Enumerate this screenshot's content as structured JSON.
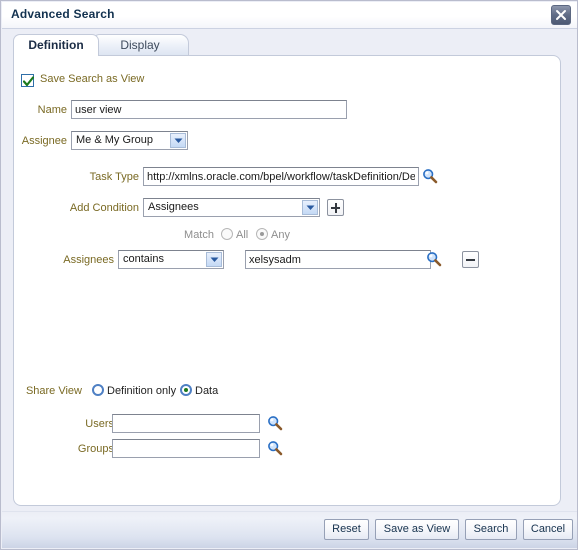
{
  "window": {
    "title": "Advanced Search",
    "close_icon": "close-icon"
  },
  "tabs": [
    {
      "label": "Definition",
      "active": true
    },
    {
      "label": "Display",
      "active": false
    }
  ],
  "form": {
    "save_search_as_view": {
      "label": "Save Search as View",
      "checked": true,
      "check_icon": "checkmark-icon"
    },
    "name": {
      "label": "Name",
      "value": "user view"
    },
    "assignee": {
      "label": "Assignee",
      "value": "Me & My Group"
    },
    "task_type": {
      "label": "Task Type",
      "value": "http://xmlns.oracle.com/bpel/workflow/taskDefinition/De",
      "search_icon": "magnifier-icon"
    },
    "add_condition": {
      "label": "Add Condition",
      "value": "Assignees",
      "add_icon": "plus-icon"
    },
    "match": {
      "label": "Match",
      "options": [
        {
          "label": "All",
          "selected": false
        },
        {
          "label": "Any",
          "selected": true
        }
      ]
    },
    "assignees_condition": {
      "label": "Assignees",
      "operator": "contains",
      "value": "xelsysadm",
      "search_icon": "magnifier-icon",
      "remove_icon": "minus-icon"
    }
  },
  "share_view": {
    "label": "Share View",
    "options": [
      {
        "label": "Definition only",
        "selected": false
      },
      {
        "label": "Data",
        "selected": true
      }
    ],
    "users": {
      "label": "Users",
      "value": "",
      "search_icon": "magnifier-icon"
    },
    "groups": {
      "label": "Groups",
      "value": "",
      "search_icon": "magnifier-icon"
    }
  },
  "footer": {
    "buttons": [
      {
        "label": "Reset"
      },
      {
        "label": "Save as View"
      },
      {
        "label": "Search"
      },
      {
        "label": "Cancel"
      }
    ]
  },
  "colors": {
    "title_text": "#12314f",
    "label_text": "#7a6a24",
    "disabled_text": "#8e8e8e",
    "panel_border": "#c3cada",
    "dialog_bg": "#eceef6"
  }
}
